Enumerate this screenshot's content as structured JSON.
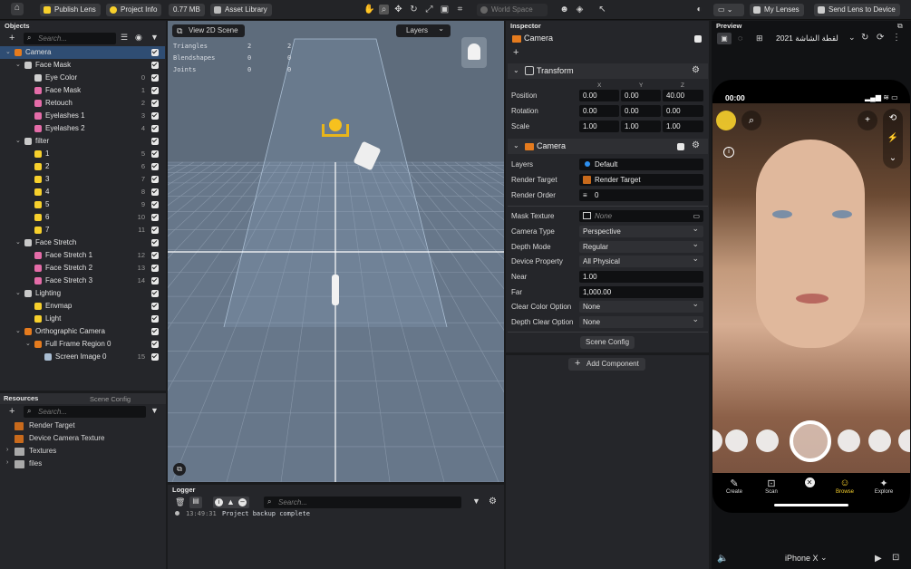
{
  "toolbar": {
    "home_icon": "home-icon",
    "publish_label": "Publish Lens",
    "project_info_label": "Project Info",
    "size_label": "0.77 MB",
    "asset_library_label": "Asset Library",
    "world_space_label": "World Space",
    "my_lenses_label": "My Lenses",
    "send_label": "Send Lens to Device"
  },
  "objects": {
    "title": "Objects",
    "search_placeholder": "Search...",
    "rows": [
      {
        "label": "Camera",
        "num": ""
      },
      {
        "label": "Face Mask",
        "num": ""
      },
      {
        "label": "Eye Color",
        "num": "0"
      },
      {
        "label": "Face Mask",
        "num": "1"
      },
      {
        "label": "Retouch",
        "num": "2"
      },
      {
        "label": "Eyelashes 1",
        "num": "3"
      },
      {
        "label": "Eyelashes 2",
        "num": "4"
      },
      {
        "label": "filter",
        "num": ""
      },
      {
        "label": "1",
        "num": "5"
      },
      {
        "label": "2",
        "num": "6"
      },
      {
        "label": "3",
        "num": "7"
      },
      {
        "label": "4",
        "num": "8"
      },
      {
        "label": "5",
        "num": "9"
      },
      {
        "label": "6",
        "num": "10"
      },
      {
        "label": "7",
        "num": "11"
      },
      {
        "label": "Face Stretch",
        "num": ""
      },
      {
        "label": "Face Stretch 1",
        "num": "12"
      },
      {
        "label": "Face Stretch 2",
        "num": "13"
      },
      {
        "label": "Face Stretch 3",
        "num": "14"
      },
      {
        "label": "Lighting",
        "num": ""
      },
      {
        "label": "Envmap",
        "num": ""
      },
      {
        "label": "Light",
        "num": ""
      },
      {
        "label": "Orthographic Camera",
        "num": ""
      },
      {
        "label": "Full Frame Region 0",
        "num": ""
      },
      {
        "label": "Screen Image 0",
        "num": "15"
      }
    ]
  },
  "resources": {
    "tab1": "Resources",
    "tab2": "Scene Config",
    "search_placeholder": "Search...",
    "items": [
      "Render Target",
      "Device Camera Texture",
      "Textures",
      "files"
    ]
  },
  "scene": {
    "view2d_label": "View 2D Scene",
    "layers_label": "Layers",
    "stats": [
      {
        "name": "Triangles",
        "a": "2",
        "b": "2"
      },
      {
        "name": "Blendshapes",
        "a": "0",
        "b": "0"
      },
      {
        "name": "Joints",
        "a": "0",
        "b": "0"
      }
    ]
  },
  "logger": {
    "title": "Logger",
    "search_placeholder": "Search...",
    "entry_time": "13:49:31",
    "entry_text": "Project backup complete"
  },
  "inspector": {
    "title": "Inspector",
    "object_name": "Camera",
    "transform_title": "Transform",
    "axis_x": "X",
    "axis_y": "Y",
    "axis_z": "Z",
    "position_label": "Position",
    "position": [
      "0.00",
      "0.00",
      "40.00"
    ],
    "rotation_label": "Rotation",
    "rotation": [
      "0.00",
      "0.00",
      "0.00"
    ],
    "scale_label": "Scale",
    "scale": [
      "1.00",
      "1.00",
      "1.00"
    ],
    "camera_title": "Camera",
    "layers_label": "Layers",
    "layers_value": "Default",
    "render_target_label": "Render Target",
    "render_target_value": "Render Target",
    "render_order_label": "Render Order",
    "render_order_value": "0",
    "mask_texture_label": "Mask Texture",
    "mask_texture_value": "None",
    "camera_type_label": "Camera Type",
    "camera_type_value": "Perspective",
    "depth_mode_label": "Depth Mode",
    "depth_mode_value": "Regular",
    "device_property_label": "Device Property",
    "device_property_value": "All Physical",
    "near_label": "Near",
    "near_value": "1.00",
    "far_label": "Far",
    "far_value": "1,000.00",
    "clear_color_label": "Clear Color Option",
    "clear_color_value": "None",
    "depth_clear_label": "Depth Clear Option",
    "depth_clear_value": "None",
    "scene_config_label": "Scene Config",
    "add_component_label": "Add Component"
  },
  "preview": {
    "title": "Preview",
    "capture_title": "لقطة الشاشة 2021",
    "time": "00:00",
    "device": "iPhone X",
    "nav": [
      "Create",
      "Scan",
      "",
      "Browse",
      "Explore"
    ]
  },
  "colors": {
    "accent_yellow": "#f7d02c",
    "selection_blue": "#2f4d73",
    "grid_bg": "#5a6a7a"
  }
}
